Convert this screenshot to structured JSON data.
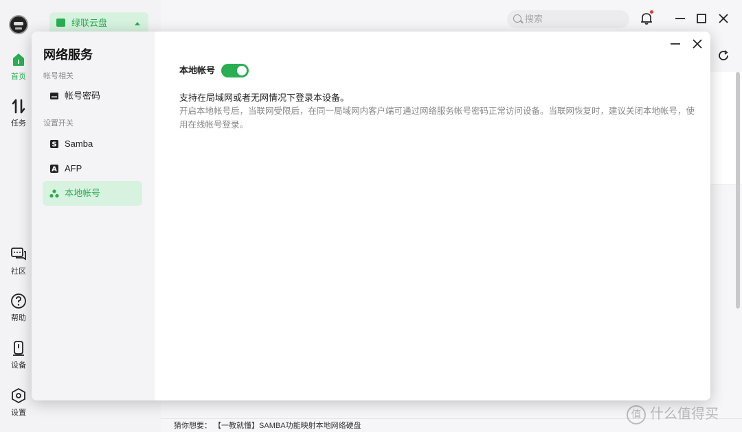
{
  "rail": {
    "items": [
      {
        "label": "首页",
        "icon": "home-icon"
      },
      {
        "label": "任务",
        "icon": "transfer-icon"
      },
      {
        "label": "社区",
        "icon": "chat-icon"
      },
      {
        "label": "帮助",
        "icon": "help-icon"
      },
      {
        "label": "设备",
        "icon": "device-icon"
      },
      {
        "label": "设置",
        "icon": "settings-icon"
      }
    ]
  },
  "background": {
    "drive_label": "绿联云盘",
    "search_placeholder": "搜索",
    "bottom_hint": "猜你想要：  【一教就懂】SAMBA功能映射本地网络硬盘",
    "watermark": "什么值得买",
    "watermark_glyph": "值"
  },
  "dialog": {
    "title": "网络服务",
    "sections": [
      {
        "label": "帐号相关"
      },
      {
        "label": "设置开关"
      }
    ],
    "items": [
      {
        "label": "帐号密码",
        "icon": "card-icon"
      },
      {
        "label": "Samba",
        "icon": "samba-icon",
        "glyph": "S"
      },
      {
        "label": "AFP",
        "icon": "afp-icon",
        "glyph": "A"
      },
      {
        "label": "本地帐号",
        "icon": "local-account-icon"
      }
    ],
    "content": {
      "toggle_label": "本地帐号",
      "toggle_on": true,
      "desc_title": "支持在局域网或者无网情况下登录本设备。",
      "desc_body": "开启本地帐号后，当联网受限后，在同一局域网内客户端可通过网络服务帐号密码正常访问设备。当联网恢复时，建议关闭本地帐号，使用在线帐号登录。"
    }
  },
  "colors": {
    "accent": "#2aae52",
    "accent_bg": "#d7f2df",
    "notification": "#e53935"
  }
}
